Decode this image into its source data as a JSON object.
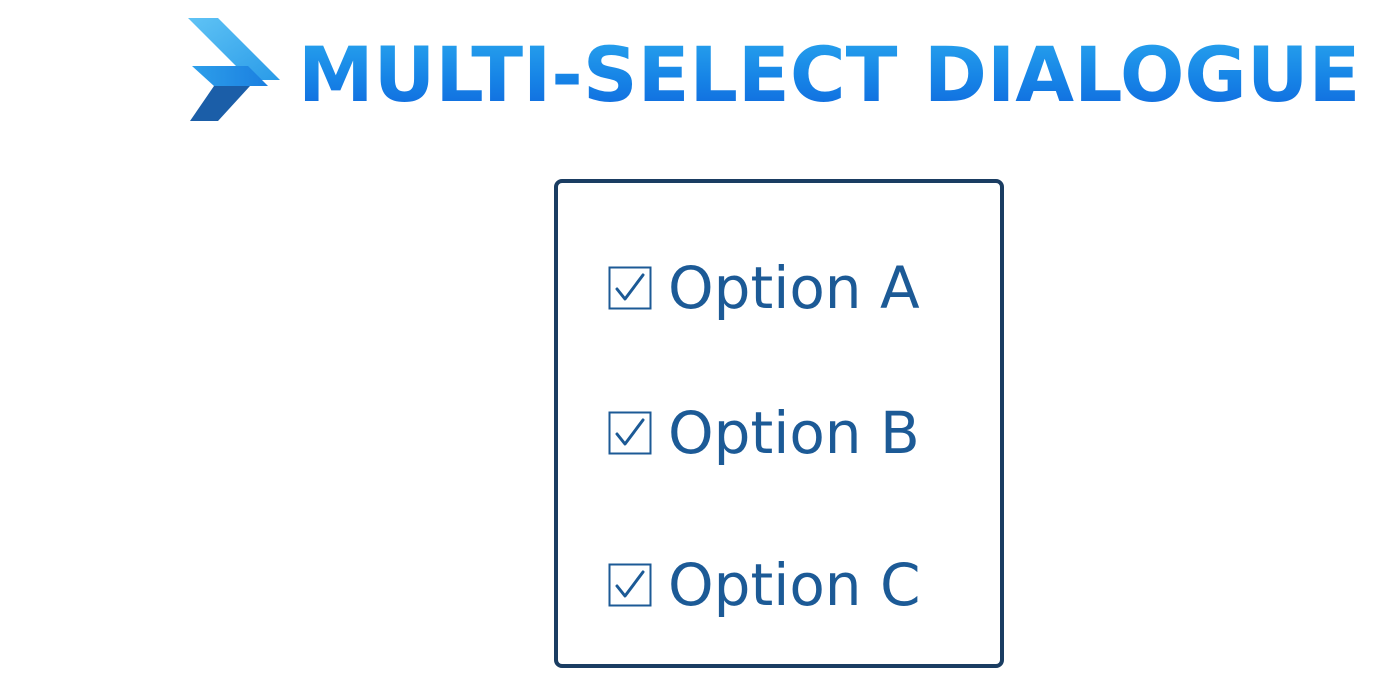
{
  "header": {
    "title": "MULTI-SELECT DIALOGUE",
    "logo_icon": "chevron-logo-icon",
    "title_gradient": [
      "#2aa7ee",
      "#0f64dc"
    ]
  },
  "dialog": {
    "border_color": "#1a3d62",
    "options": [
      {
        "label": "Option A",
        "checked": true
      },
      {
        "label": "Option B",
        "checked": true
      },
      {
        "label": "Option C",
        "checked": true
      }
    ]
  },
  "colors": {
    "text": "#1c5a96",
    "checkbox": "#1c5a96"
  }
}
